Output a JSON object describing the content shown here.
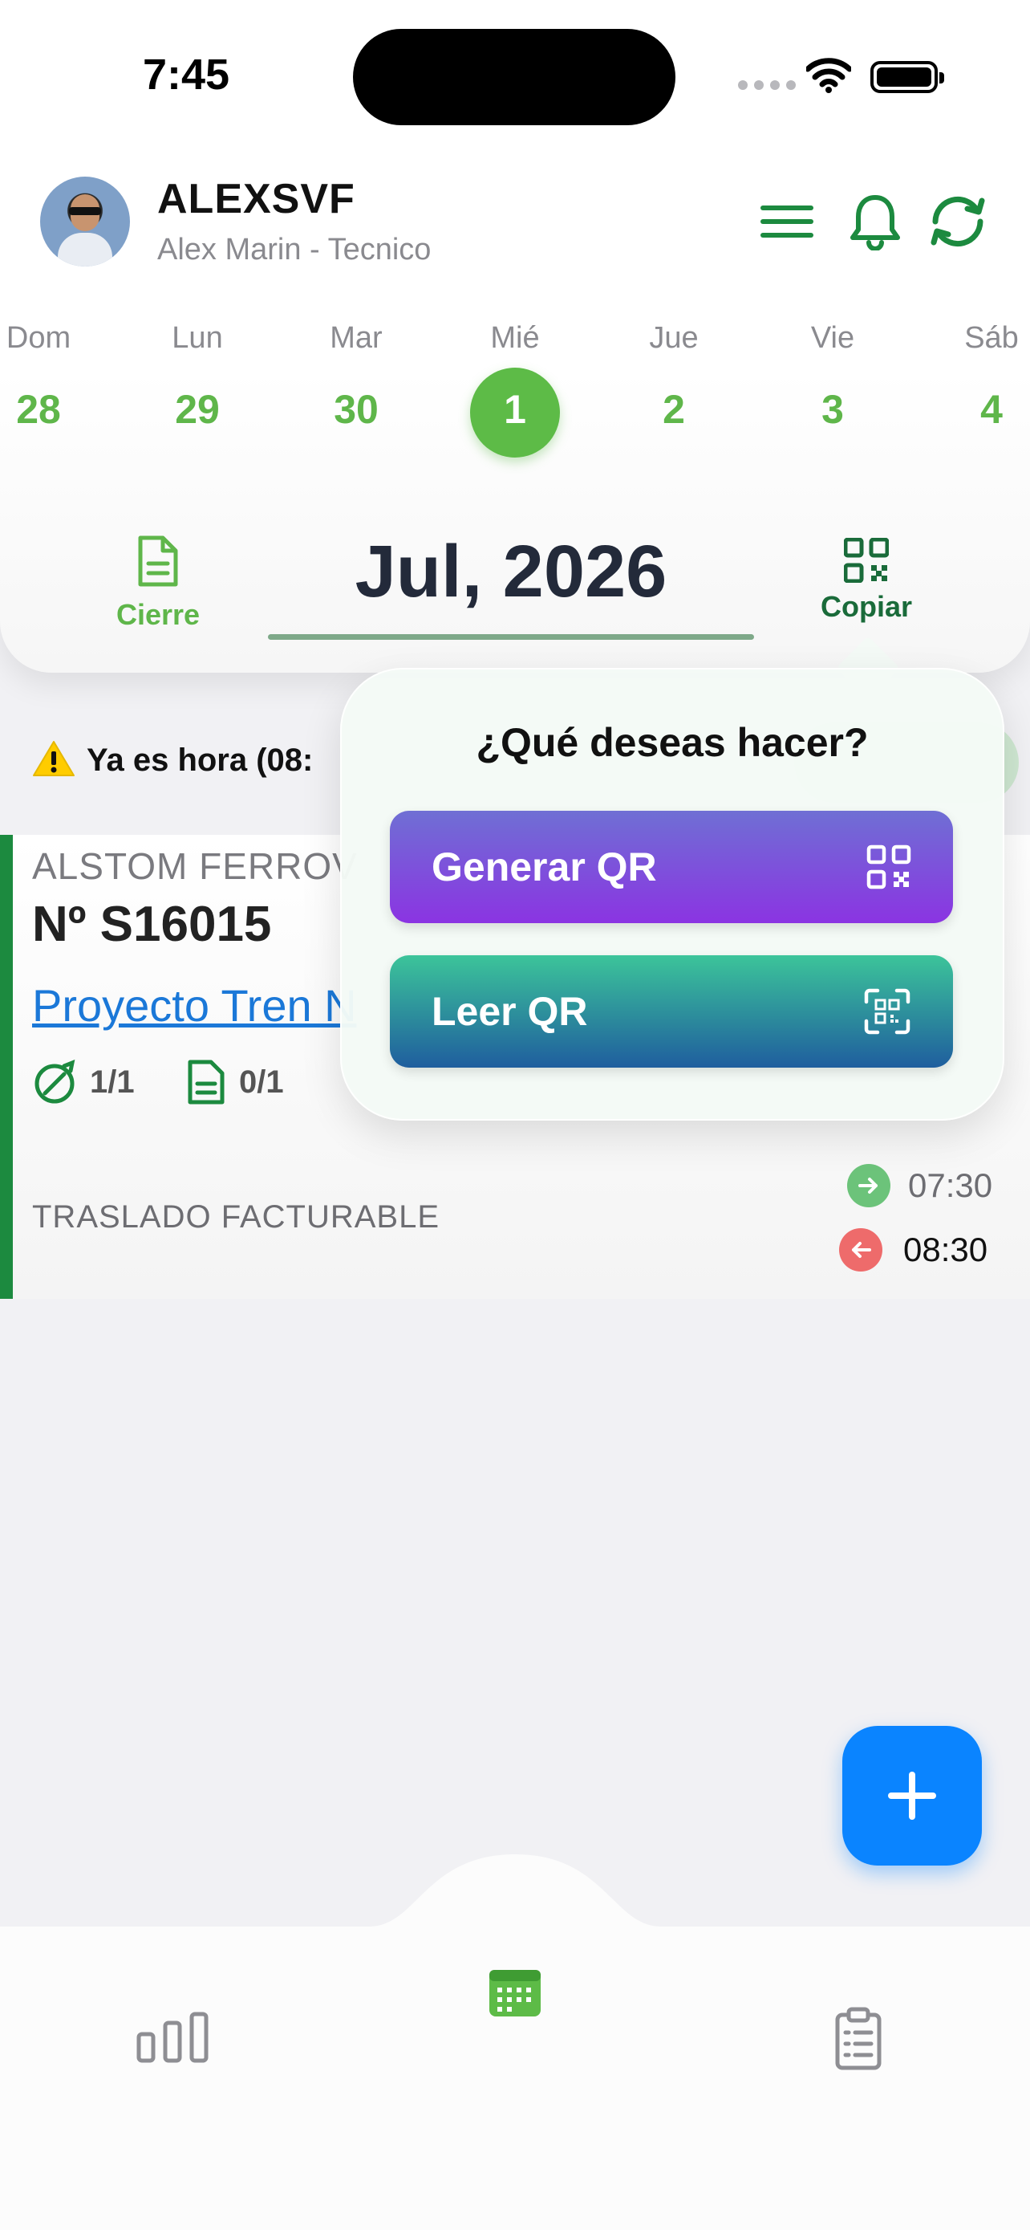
{
  "status_bar": {
    "time": "7:45"
  },
  "user": {
    "name": "ALEXSVF",
    "role": "Alex Marin - Tecnico"
  },
  "week": {
    "days": [
      {
        "name": "Dom",
        "date": "28"
      },
      {
        "name": "Lun",
        "date": "29"
      },
      {
        "name": "Mar",
        "date": "30"
      },
      {
        "name": "Mié",
        "date": "1"
      },
      {
        "name": "Jue",
        "date": "2"
      },
      {
        "name": "Vie",
        "date": "3"
      },
      {
        "name": "Sáb",
        "date": "4"
      }
    ],
    "selected_index": 3
  },
  "month": {
    "title": "Jul, 2026",
    "close_label": "Cierre",
    "copy_label": "Copiar"
  },
  "warning": {
    "text": "Ya es hora (08:"
  },
  "job": {
    "client": "ALSTOM FERROV",
    "number": "Nº S16015",
    "project": "Proyecto Tren N",
    "stats": [
      {
        "icon": "compass-icon",
        "value": "1/1"
      },
      {
        "icon": "document-icon",
        "value": "0/1"
      }
    ],
    "type": "TRASLADO FACTURABLE",
    "start_time": "07:30",
    "end_time": "08:30"
  },
  "popover": {
    "title": "¿Qué deseas hacer?",
    "generate_label": "Generar QR",
    "read_label": "Leer QR"
  },
  "colors": {
    "accent_green": "#5dbb47",
    "dark_green": "#1c8a3f",
    "fab_blue": "#0a84ff",
    "generate_gradient": [
      "#6f6fd4",
      "#8b34e2"
    ],
    "read_gradient": [
      "#3cc49a",
      "#1f5e9e"
    ]
  }
}
